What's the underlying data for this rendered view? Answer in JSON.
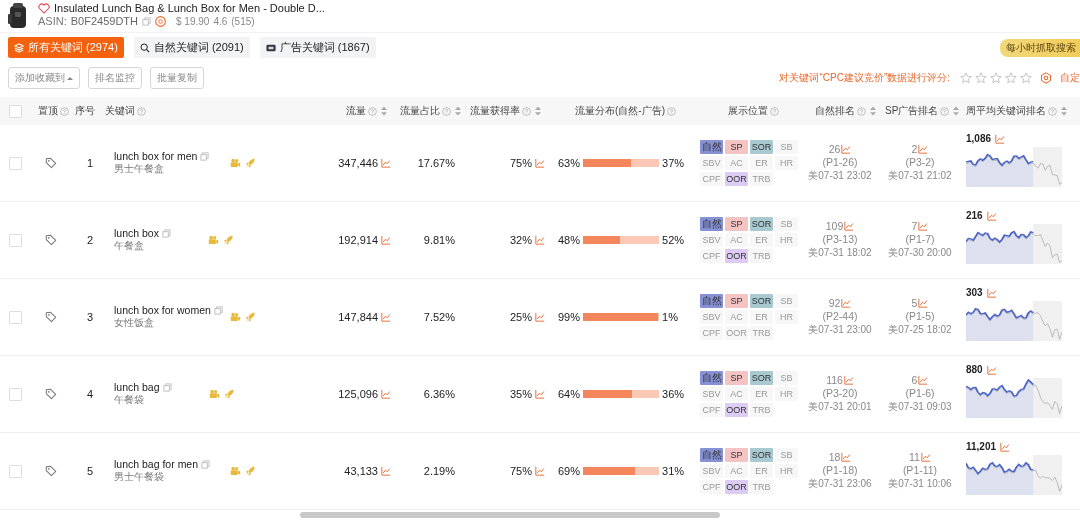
{
  "product": {
    "title": "Insulated Lunch Bag & Lunch Box for Men - Double D...",
    "asin_label": "ASIN:",
    "asin": "B0F2459DTH",
    "price": "$ 19.90",
    "rating": "4.6",
    "reviews": "(515)",
    "favorite": false
  },
  "tabs": [
    {
      "label": "所有关键词 (2974)",
      "selected": true,
      "kind": "all"
    },
    {
      "label": "自然关键词 (2091)",
      "selected": false,
      "kind": "organic"
    },
    {
      "label": "广告关键词 (1867)",
      "selected": false,
      "kind": "ad"
    }
  ],
  "badge": "每小时抓取搜索",
  "toolbar": [
    {
      "label": "添加收藏到",
      "dropdown": true
    },
    {
      "label": "排名监控",
      "dropdown": false
    },
    {
      "label": "批量复制",
      "dropdown": false
    }
  ],
  "rating": {
    "label": "对关键词“CPC建议竞价”数据进行评分:",
    "stars": 0,
    "custom": "自定"
  },
  "select_all_checked": false,
  "columns": [
    {
      "label": "置顶",
      "help": true,
      "sortable": false
    },
    {
      "label": "序号",
      "help": false,
      "sortable": false
    },
    {
      "label": "关键词",
      "help": true,
      "sortable": false
    },
    {
      "label": "流量",
      "help": true,
      "sortable": true
    },
    {
      "label": "流量占比",
      "help": true,
      "sortable": true
    },
    {
      "label": "流量获得率",
      "help": true,
      "sortable": true
    },
    {
      "label": "流量分布(自然-广告)",
      "help": true,
      "sortable": false
    },
    {
      "label": "展示位置",
      "help": true,
      "sortable": false
    },
    {
      "label": "自然排名",
      "help": true,
      "sortable": true
    },
    {
      "label": "SP广告排名",
      "help": true,
      "sortable": true
    },
    {
      "label": "周平均关键词排名",
      "help": true,
      "sortable": true
    }
  ],
  "rows": [
    {
      "checked": false,
      "index": "1",
      "keyword": "lunch box for men",
      "translation": "男士午餐盒",
      "traffic": "347,446",
      "share": "17.67%",
      "rate": "75%",
      "organic_pct": "63%",
      "ad_pct": "37%",
      "level": 0.63,
      "tags": [
        {
          "label": "自然",
          "on": true,
          "color": "#8791d6"
        },
        {
          "label": "SP",
          "on": true,
          "color": "#f4c4c4"
        },
        {
          "label": "SOR",
          "on": true,
          "color": "#a8c9d0"
        },
        {
          "label": "SB",
          "on": false
        },
        {
          "label": "SBV",
          "on": false
        },
        {
          "label": "AC",
          "on": false
        },
        {
          "label": "ER",
          "on": false
        },
        {
          "label": "HR",
          "on": false
        },
        {
          "label": "CPF",
          "on": false
        },
        {
          "label": "OOR",
          "on": true,
          "color": "#dccbf3"
        },
        {
          "label": "TRB",
          "on": false
        }
      ],
      "natural": {
        "rank": "26",
        "page": "(P1-26)",
        "time": "美07-31 23:02"
      },
      "sp": {
        "rank": "2",
        "page": "(P3-2)",
        "time": "美07-31 21:02"
      },
      "weekly": "1,086"
    },
    {
      "checked": false,
      "index": "2",
      "keyword": "lunch box",
      "translation": "午餐盒",
      "traffic": "192,914",
      "share": "9.81%",
      "rate": "32%",
      "organic_pct": "48%",
      "ad_pct": "52%",
      "level": 0.48,
      "tags": [
        {
          "label": "自然",
          "on": true,
          "color": "#8791d6"
        },
        {
          "label": "SP",
          "on": true,
          "color": "#f4c4c4"
        },
        {
          "label": "SOR",
          "on": true,
          "color": "#a8c9d0"
        },
        {
          "label": "SB",
          "on": false
        },
        {
          "label": "SBV",
          "on": false
        },
        {
          "label": "AC",
          "on": false
        },
        {
          "label": "ER",
          "on": false
        },
        {
          "label": "HR",
          "on": false
        },
        {
          "label": "CPF",
          "on": false
        },
        {
          "label": "OOR",
          "on": true,
          "color": "#dccbf3"
        },
        {
          "label": "TRB",
          "on": false
        }
      ],
      "natural": {
        "rank": "109",
        "page": "(P3-13)",
        "time": "美07-31 18:02"
      },
      "sp": {
        "rank": "7",
        "page": "(P1-7)",
        "time": "美07-30 20:00"
      },
      "weekly": "216"
    },
    {
      "checked": false,
      "index": "3",
      "keyword": "lunch box for women",
      "translation": "女性饭盒",
      "traffic": "147,844",
      "share": "7.52%",
      "rate": "25%",
      "organic_pct": "99%",
      "ad_pct": "1%",
      "level": 0.99,
      "tags": [
        {
          "label": "自然",
          "on": true,
          "color": "#8791d6"
        },
        {
          "label": "SP",
          "on": true,
          "color": "#f4c4c4"
        },
        {
          "label": "SOR",
          "on": true,
          "color": "#a8c9d0"
        },
        {
          "label": "SB",
          "on": false
        },
        {
          "label": "SBV",
          "on": false
        },
        {
          "label": "AC",
          "on": false
        },
        {
          "label": "ER",
          "on": false
        },
        {
          "label": "HR",
          "on": false
        },
        {
          "label": "CPF",
          "on": false
        },
        {
          "label": "OOR",
          "on": false
        },
        {
          "label": "TRB",
          "on": false
        }
      ],
      "natural": {
        "rank": "92",
        "page": "(P2-44)",
        "time": "美07-31 23:00"
      },
      "sp": {
        "rank": "5",
        "page": "(P1-5)",
        "time": "美07-25 18:02"
      },
      "weekly": "303"
    },
    {
      "checked": false,
      "index": "4",
      "keyword": "lunch bag",
      "translation": "午餐袋",
      "traffic": "125,096",
      "share": "6.36%",
      "rate": "35%",
      "organic_pct": "64%",
      "ad_pct": "36%",
      "level": 0.64,
      "tags": [
        {
          "label": "自然",
          "on": true,
          "color": "#8791d6"
        },
        {
          "label": "SP",
          "on": true,
          "color": "#f4c4c4"
        },
        {
          "label": "SOR",
          "on": true,
          "color": "#a8c9d0"
        },
        {
          "label": "SB",
          "on": false
        },
        {
          "label": "SBV",
          "on": false
        },
        {
          "label": "AC",
          "on": false
        },
        {
          "label": "ER",
          "on": false
        },
        {
          "label": "HR",
          "on": false
        },
        {
          "label": "CPF",
          "on": false
        },
        {
          "label": "OOR",
          "on": true,
          "color": "#dccbf3"
        },
        {
          "label": "TRB",
          "on": false
        }
      ],
      "natural": {
        "rank": "116",
        "page": "(P3-20)",
        "time": "美07-31 20:01"
      },
      "sp": {
        "rank": "6",
        "page": "(P1-6)",
        "time": "美07-31 09:03"
      },
      "weekly": "880"
    },
    {
      "checked": false,
      "index": "5",
      "keyword": "lunch bag for men",
      "translation": "男士午餐袋",
      "traffic": "43,133",
      "share": "2.19%",
      "rate": "75%",
      "organic_pct": "69%",
      "ad_pct": "31%",
      "level": 0.69,
      "tags": [
        {
          "label": "自然",
          "on": true,
          "color": "#8791d6"
        },
        {
          "label": "SP",
          "on": true,
          "color": "#f4c4c4"
        },
        {
          "label": "SOR",
          "on": true,
          "color": "#a8c9d0"
        },
        {
          "label": "SB",
          "on": false
        },
        {
          "label": "SBV",
          "on": false
        },
        {
          "label": "AC",
          "on": false
        },
        {
          "label": "ER",
          "on": false
        },
        {
          "label": "HR",
          "on": false
        },
        {
          "label": "CPF",
          "on": false
        },
        {
          "label": "OOR",
          "on": true,
          "color": "#dccbf3"
        },
        {
          "label": "TRB",
          "on": false
        }
      ],
      "natural": {
        "rank": "18",
        "page": "(P1-18)",
        "time": "美07-31 23:06"
      },
      "sp": {
        "rank": "11",
        "page": "(P1-11)",
        "time": "美07-31 10:06"
      },
      "weekly": "11,201"
    }
  ]
}
